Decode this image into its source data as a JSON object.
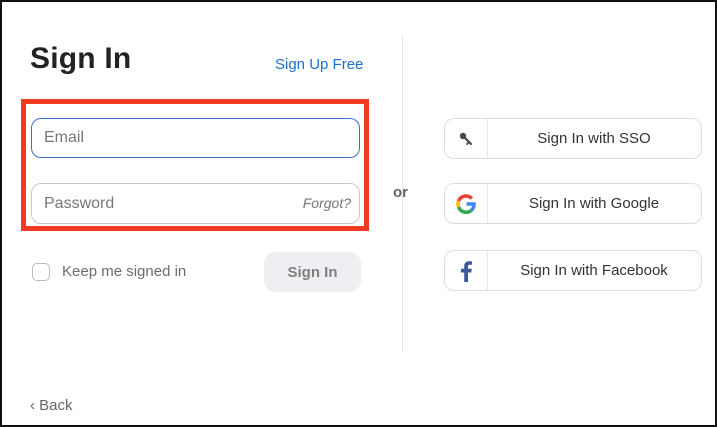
{
  "signin": {
    "title": "Sign In",
    "signup_link": "Sign Up Free",
    "email_placeholder": "Email",
    "password_placeholder": "Password",
    "forgot_link": "Forgot?",
    "keep_signed_in_label": "Keep me signed in",
    "sign_in_button": "Sign In"
  },
  "separator": {
    "text": "or"
  },
  "sso": {
    "buttons": [
      {
        "label": "Sign In with SSO",
        "icon": "key-icon"
      },
      {
        "label": "Sign In with Google",
        "icon": "google-icon"
      },
      {
        "label": "Sign In with Facebook",
        "icon": "facebook-icon"
      }
    ]
  },
  "footer": {
    "back_label": "Back"
  },
  "colors": {
    "accent_link": "#1b6fd1",
    "highlight_border": "#ef3b24",
    "email_border": "#3d6fc6",
    "facebook_blue": "#3b5998"
  }
}
